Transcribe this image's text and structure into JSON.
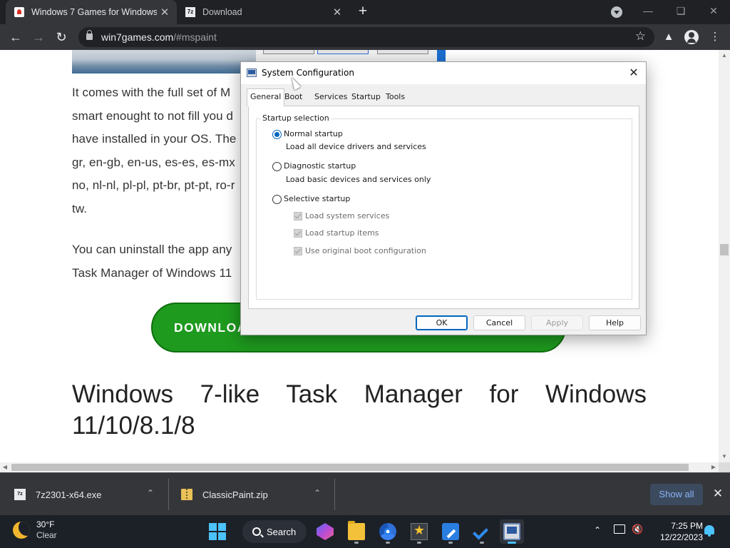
{
  "browser": {
    "tabs": [
      {
        "label": "Windows 7 Games for Windows",
        "active": true,
        "favicon": "cards-icon"
      },
      {
        "label": "Download",
        "active": false,
        "favicon": "7zip-icon"
      }
    ],
    "url": {
      "host": "win7games.com",
      "path": "/#mspaint"
    },
    "new_tab_icon": "+",
    "close_icon": "✕"
  },
  "page": {
    "paragraph1": "It comes with the full set of M smart enought to not fill you d have installed in your OS. The gr, en-gb, en-us, es-es, es-mx no, nl-nl, pl-pl, pt-br, pt-pt, ro-r tw.",
    "paragraph2": "You can uninstall the app any Task Manager of Windows 11",
    "download_button": "DOWNLOA",
    "heading_line1": "Windows 7-like Task Manager for Windows",
    "heading_line2": "11/10/8.1/8"
  },
  "dialog": {
    "title": "System Configuration",
    "tabs": [
      "General",
      "Boot",
      "Services",
      "Startup",
      "Tools"
    ],
    "selected_tab": "General",
    "group_caption": "Startup selection",
    "options": [
      {
        "label": "Normal startup",
        "description": "Load all device drivers and services",
        "selected": true
      },
      {
        "label": "Diagnostic startup",
        "description": "Load basic devices and services only",
        "selected": false
      },
      {
        "label": "Selective startup",
        "selected": false
      }
    ],
    "selective_items": [
      {
        "label": "Load system services",
        "checked": true,
        "enabled": false
      },
      {
        "label": "Load startup items",
        "checked": true,
        "enabled": false
      },
      {
        "label": "Use original boot configuration",
        "checked": true,
        "enabled": false
      }
    ],
    "buttons": {
      "ok": "OK",
      "cancel": "Cancel",
      "apply": "Apply",
      "help": "Help"
    }
  },
  "downloads": {
    "items": [
      {
        "filename": "7z2301-x64.exe",
        "icon": "7zip-file-icon"
      },
      {
        "filename": "ClassicPaint.zip",
        "icon": "zip-file-icon"
      }
    ],
    "show_all": "Show all"
  },
  "taskbar": {
    "weather": {
      "temp": "30°F",
      "condition": "Clear"
    },
    "search_label": "Search",
    "clock": {
      "time": "7:25 PM",
      "date": "12/22/2023"
    }
  },
  "colors": {
    "download_green": "#1e9a1e",
    "accent_blue": "#0067c0",
    "taskbar": "#1c2027"
  }
}
